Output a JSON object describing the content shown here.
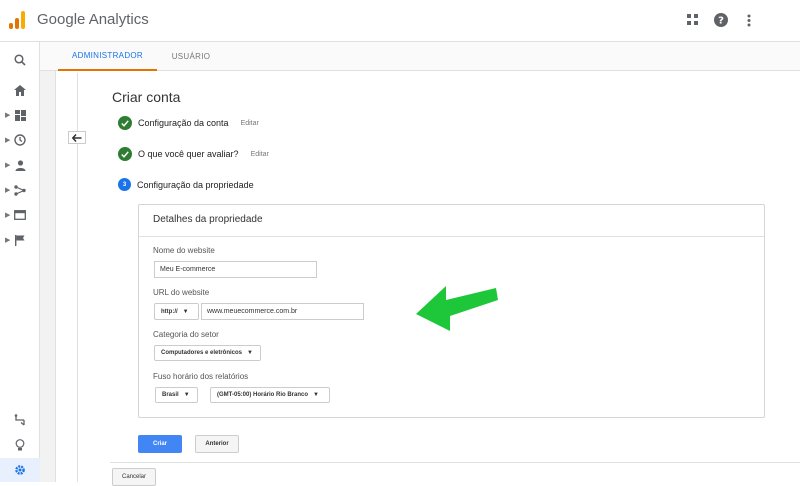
{
  "app": {
    "brand": "Google Analytics"
  },
  "tabs": [
    {
      "label": "ADMINISTRADOR",
      "active": true
    },
    {
      "label": "USUÁRIO",
      "active": false
    }
  ],
  "page": {
    "title": "Criar conta"
  },
  "steps": [
    {
      "title": "Configuração da conta",
      "edit": "Editar",
      "status": "done"
    },
    {
      "title": "O que você quer avaliar?",
      "edit": "Editar",
      "status": "done"
    },
    {
      "title": "Configuração da propriedade",
      "number": "3",
      "status": "current"
    }
  ],
  "card": {
    "title": "Detalhes da propriedade",
    "website_name_label": "Nome do website",
    "website_name_value": "Meu E-commerce",
    "url_label": "URL do website",
    "protocol": "http://",
    "url_value": "www.meuecommerce.com.br",
    "category_label": "Categoria do setor",
    "category_value": "Computadores e eletrônicos",
    "timezone_label": "Fuso horário dos relatórios",
    "country_value": "Brasil",
    "timezone_value": "(GMT-05:00) Horário Rio Branco"
  },
  "buttons": {
    "create": "Criar",
    "previous": "Anterior",
    "cancel": "Cancelar"
  },
  "colors": {
    "accent": "#1a73e8",
    "primary_button": "#4285f4",
    "step_done": "#2e7d32",
    "tab_underline": "#e37400",
    "annotation_arrow": "#1ec73a"
  }
}
